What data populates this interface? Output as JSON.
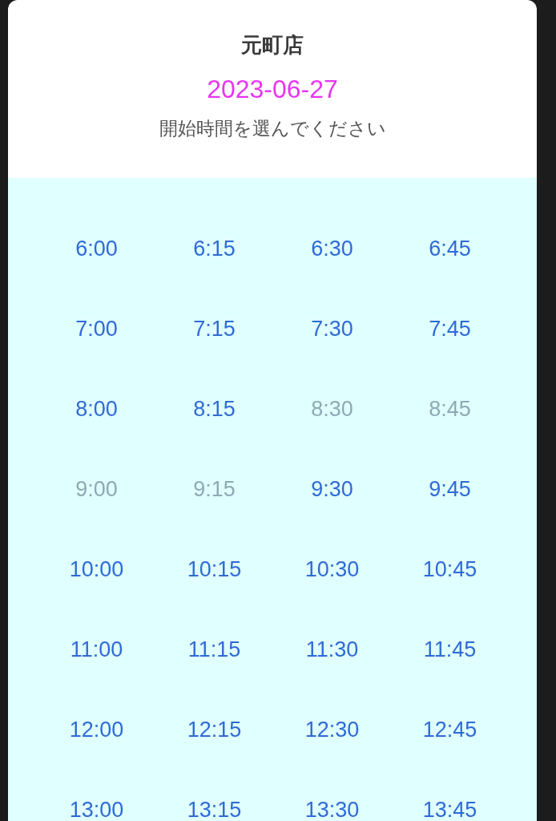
{
  "header": {
    "store": "元町店",
    "date": "2023-06-27",
    "prompt": "開始時間を選んでください"
  },
  "slots": [
    {
      "time": "6:00",
      "disabled": false
    },
    {
      "time": "6:15",
      "disabled": false
    },
    {
      "time": "6:30",
      "disabled": false
    },
    {
      "time": "6:45",
      "disabled": false
    },
    {
      "time": "7:00",
      "disabled": false
    },
    {
      "time": "7:15",
      "disabled": false
    },
    {
      "time": "7:30",
      "disabled": false
    },
    {
      "time": "7:45",
      "disabled": false
    },
    {
      "time": "8:00",
      "disabled": false
    },
    {
      "time": "8:15",
      "disabled": false
    },
    {
      "time": "8:30",
      "disabled": true
    },
    {
      "time": "8:45",
      "disabled": true
    },
    {
      "time": "9:00",
      "disabled": true
    },
    {
      "time": "9:15",
      "disabled": true
    },
    {
      "time": "9:30",
      "disabled": false
    },
    {
      "time": "9:45",
      "disabled": false
    },
    {
      "time": "10:00",
      "disabled": false
    },
    {
      "time": "10:15",
      "disabled": false
    },
    {
      "time": "10:30",
      "disabled": false
    },
    {
      "time": "10:45",
      "disabled": false
    },
    {
      "time": "11:00",
      "disabled": false
    },
    {
      "time": "11:15",
      "disabled": false
    },
    {
      "time": "11:30",
      "disabled": false
    },
    {
      "time": "11:45",
      "disabled": false
    },
    {
      "time": "12:00",
      "disabled": false
    },
    {
      "time": "12:15",
      "disabled": false
    },
    {
      "time": "12:30",
      "disabled": false
    },
    {
      "time": "12:45",
      "disabled": false
    },
    {
      "time": "13:00",
      "disabled": false
    },
    {
      "time": "13:15",
      "disabled": false
    },
    {
      "time": "13:30",
      "disabled": false
    },
    {
      "time": "13:45",
      "disabled": false
    }
  ]
}
